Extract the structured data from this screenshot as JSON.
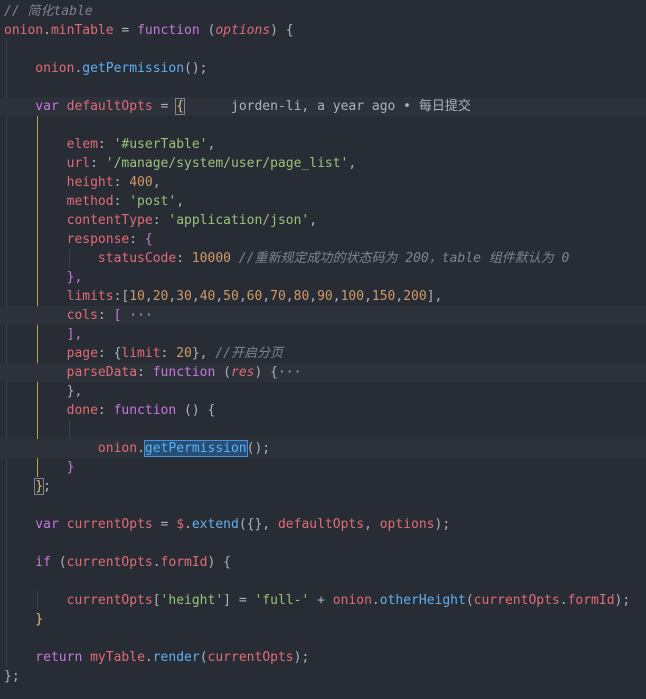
{
  "editor": {
    "theme": {
      "background": "#282c34",
      "active_line": "#2c313a",
      "selection": "#264f78"
    },
    "blame": {
      "author": "jorden-li",
      "time": "a year ago",
      "message": "每日提交"
    },
    "lines": [
      {
        "segs": [
          {
            "t": "// 简化table",
            "c": "comment"
          }
        ]
      },
      {
        "segs": [
          {
            "t": "onion",
            "c": "var"
          },
          {
            "t": ".",
            "c": "punc"
          },
          {
            "t": "minTable",
            "c": "var"
          },
          {
            "t": " = ",
            "c": "punc"
          },
          {
            "t": "function",
            "c": "kw"
          },
          {
            "t": " (",
            "c": "punc"
          },
          {
            "t": "options",
            "c": "param"
          },
          {
            "t": ") {",
            "c": "punc"
          }
        ]
      },
      {
        "segs": [
          {
            "t": "",
            "c": "punc"
          }
        ]
      },
      {
        "segs": [
          {
            "t": "    onion",
            "c": "var"
          },
          {
            "t": ".",
            "c": "punc"
          },
          {
            "t": "getPermission",
            "c": "fn",
            "hl": true
          },
          {
            "t": "();",
            "c": "punc"
          }
        ]
      },
      {
        "segs": [
          {
            "t": "",
            "c": "punc"
          }
        ]
      },
      {
        "segs": [
          {
            "t": "    var",
            "c": "kw"
          },
          {
            "t": " defaultOpts",
            "c": "var"
          },
          {
            "t": " = ",
            "c": "punc"
          },
          {
            "t": "{",
            "c": "brace",
            "box": true
          },
          {
            "t": "      jorden-li, a year ago • 每日提交",
            "c": "blame"
          }
        ],
        "active": true
      },
      {
        "segs": [
          {
            "t": "",
            "c": "punc"
          }
        ]
      },
      {
        "segs": [
          {
            "t": "        elem",
            "c": "var"
          },
          {
            "t": ": ",
            "c": "punc"
          },
          {
            "t": "'#userTable'",
            "c": "str"
          },
          {
            "t": ",",
            "c": "punc"
          }
        ]
      },
      {
        "segs": [
          {
            "t": "        url",
            "c": "var"
          },
          {
            "t": ": ",
            "c": "punc"
          },
          {
            "t": "'/manage/system/user/page_list'",
            "c": "str"
          },
          {
            "t": ",",
            "c": "punc"
          }
        ]
      },
      {
        "segs": [
          {
            "t": "        height",
            "c": "var"
          },
          {
            "t": ": ",
            "c": "punc"
          },
          {
            "t": "400",
            "c": "num"
          },
          {
            "t": ",",
            "c": "punc"
          }
        ]
      },
      {
        "segs": [
          {
            "t": "        method",
            "c": "var"
          },
          {
            "t": ": ",
            "c": "punc"
          },
          {
            "t": "'post'",
            "c": "str"
          },
          {
            "t": ",",
            "c": "punc"
          }
        ]
      },
      {
        "segs": [
          {
            "t": "        contentType",
            "c": "var"
          },
          {
            "t": ": ",
            "c": "punc"
          },
          {
            "t": "'application/json'",
            "c": "str"
          },
          {
            "t": ",",
            "c": "punc"
          }
        ]
      },
      {
        "segs": [
          {
            "t": "        response",
            "c": "var"
          },
          {
            "t": ": ",
            "c": "punc"
          },
          {
            "t": "{",
            "c": "kw"
          }
        ]
      },
      {
        "segs": [
          {
            "t": "            statusCode",
            "c": "var"
          },
          {
            "t": ": ",
            "c": "punc"
          },
          {
            "t": "10000",
            "c": "num"
          },
          {
            "t": " //重新规定成功的状态码为 200，table 组件默认为 0",
            "c": "comment"
          }
        ]
      },
      {
        "segs": [
          {
            "t": "        },",
            "c": "kw"
          }
        ]
      },
      {
        "segs": [
          {
            "t": "        limits",
            "c": "var"
          },
          {
            "t": ":[",
            "c": "punc"
          },
          {
            "t": "10",
            "c": "num"
          },
          {
            "t": ",",
            "c": "punc"
          },
          {
            "t": "20",
            "c": "num"
          },
          {
            "t": ",",
            "c": "punc"
          },
          {
            "t": "30",
            "c": "num"
          },
          {
            "t": ",",
            "c": "punc"
          },
          {
            "t": "40",
            "c": "num"
          },
          {
            "t": ",",
            "c": "punc"
          },
          {
            "t": "50",
            "c": "num"
          },
          {
            "t": ",",
            "c": "punc"
          },
          {
            "t": "60",
            "c": "num"
          },
          {
            "t": ",",
            "c": "punc"
          },
          {
            "t": "70",
            "c": "num"
          },
          {
            "t": ",",
            "c": "punc"
          },
          {
            "t": "80",
            "c": "num"
          },
          {
            "t": ",",
            "c": "punc"
          },
          {
            "t": "90",
            "c": "num"
          },
          {
            "t": ",",
            "c": "punc"
          },
          {
            "t": "100",
            "c": "num"
          },
          {
            "t": ",",
            "c": "punc"
          },
          {
            "t": "150",
            "c": "num"
          },
          {
            "t": ",",
            "c": "punc"
          },
          {
            "t": "200",
            "c": "num"
          },
          {
            "t": "],",
            "c": "punc"
          }
        ]
      },
      {
        "segs": [
          {
            "t": "        cols",
            "c": "var"
          },
          {
            "t": ": ",
            "c": "punc"
          },
          {
            "t": "[",
            "c": "kw"
          },
          {
            "t": " ···",
            "c": "ellipsis"
          }
        ],
        "active": true
      },
      {
        "segs": [
          {
            "t": "        ],",
            "c": "kw"
          }
        ]
      },
      {
        "segs": [
          {
            "t": "        page",
            "c": "var"
          },
          {
            "t": ": {",
            "c": "punc"
          },
          {
            "t": "limit",
            "c": "var"
          },
          {
            "t": ": ",
            "c": "punc"
          },
          {
            "t": "20",
            "c": "num"
          },
          {
            "t": "}, ",
            "c": "punc"
          },
          {
            "t": "//开启分页",
            "c": "comment"
          }
        ]
      },
      {
        "segs": [
          {
            "t": "        parseData",
            "c": "var"
          },
          {
            "t": ": ",
            "c": "punc"
          },
          {
            "t": "function",
            "c": "kw"
          },
          {
            "t": " (",
            "c": "punc"
          },
          {
            "t": "res",
            "c": "param"
          },
          {
            "t": ") {",
            "c": "punc"
          },
          {
            "t": "···",
            "c": "ellipsis"
          }
        ],
        "active": true
      },
      {
        "segs": [
          {
            "t": "        },",
            "c": "punc"
          }
        ]
      },
      {
        "segs": [
          {
            "t": "        done",
            "c": "var"
          },
          {
            "t": ": ",
            "c": "punc"
          },
          {
            "t": "function",
            "c": "kw"
          },
          {
            "t": " () {",
            "c": "punc"
          }
        ]
      },
      {
        "segs": [
          {
            "t": "",
            "c": "punc"
          }
        ]
      },
      {
        "segs": [
          {
            "t": "            onion",
            "c": "var"
          },
          {
            "t": ".",
            "c": "punc"
          },
          {
            "t": "getPermission",
            "c": "fn",
            "sel": true
          },
          {
            "t": "();",
            "c": "punc"
          }
        ],
        "active": true
      },
      {
        "segs": [
          {
            "t": "        }",
            "c": "kw"
          }
        ]
      },
      {
        "segs": [
          {
            "t": "    ",
            "c": "punc"
          },
          {
            "t": "}",
            "c": "brace",
            "box": true
          },
          {
            "t": ";",
            "c": "punc"
          }
        ]
      },
      {
        "segs": [
          {
            "t": "",
            "c": "punc"
          }
        ]
      },
      {
        "segs": [
          {
            "t": "    var",
            "c": "kw"
          },
          {
            "t": " currentOpts",
            "c": "var"
          },
          {
            "t": " = ",
            "c": "punc"
          },
          {
            "t": "$",
            "c": "var"
          },
          {
            "t": ".",
            "c": "punc"
          },
          {
            "t": "extend",
            "c": "fn"
          },
          {
            "t": "({}, ",
            "c": "punc"
          },
          {
            "t": "defaultOpts",
            "c": "var"
          },
          {
            "t": ", ",
            "c": "punc"
          },
          {
            "t": "options",
            "c": "var"
          },
          {
            "t": ");",
            "c": "punc"
          }
        ]
      },
      {
        "segs": [
          {
            "t": "",
            "c": "punc"
          }
        ]
      },
      {
        "segs": [
          {
            "t": "    if",
            "c": "kw"
          },
          {
            "t": " (",
            "c": "punc"
          },
          {
            "t": "currentOpts",
            "c": "var"
          },
          {
            "t": ".",
            "c": "punc"
          },
          {
            "t": "formId",
            "c": "var"
          },
          {
            "t": ") {",
            "c": "punc"
          }
        ]
      },
      {
        "segs": [
          {
            "t": "",
            "c": "punc"
          }
        ]
      },
      {
        "segs": [
          {
            "t": "        currentOpts",
            "c": "var"
          },
          {
            "t": "[",
            "c": "punc"
          },
          {
            "t": "'height'",
            "c": "str"
          },
          {
            "t": "] = ",
            "c": "punc"
          },
          {
            "t": "'full-'",
            "c": "str"
          },
          {
            "t": " + ",
            "c": "punc"
          },
          {
            "t": "onion",
            "c": "var"
          },
          {
            "t": ".",
            "c": "punc"
          },
          {
            "t": "otherHeight",
            "c": "fn"
          },
          {
            "t": "(",
            "c": "punc"
          },
          {
            "t": "currentOpts",
            "c": "var"
          },
          {
            "t": ".",
            "c": "punc"
          },
          {
            "t": "formId",
            "c": "var"
          },
          {
            "t": ");",
            "c": "punc"
          }
        ]
      },
      {
        "segs": [
          {
            "t": "    }",
            "c": "brace"
          }
        ]
      },
      {
        "segs": [
          {
            "t": "",
            "c": "punc"
          }
        ]
      },
      {
        "segs": [
          {
            "t": "    return",
            "c": "kw"
          },
          {
            "t": " myTable",
            "c": "var"
          },
          {
            "t": ".",
            "c": "punc"
          },
          {
            "t": "render",
            "c": "fn"
          },
          {
            "t": "(",
            "c": "punc"
          },
          {
            "t": "currentOpts",
            "c": "var"
          },
          {
            "t": ");",
            "c": "punc"
          }
        ]
      },
      {
        "segs": [
          {
            "t": "};",
            "c": "punc"
          }
        ]
      }
    ]
  }
}
